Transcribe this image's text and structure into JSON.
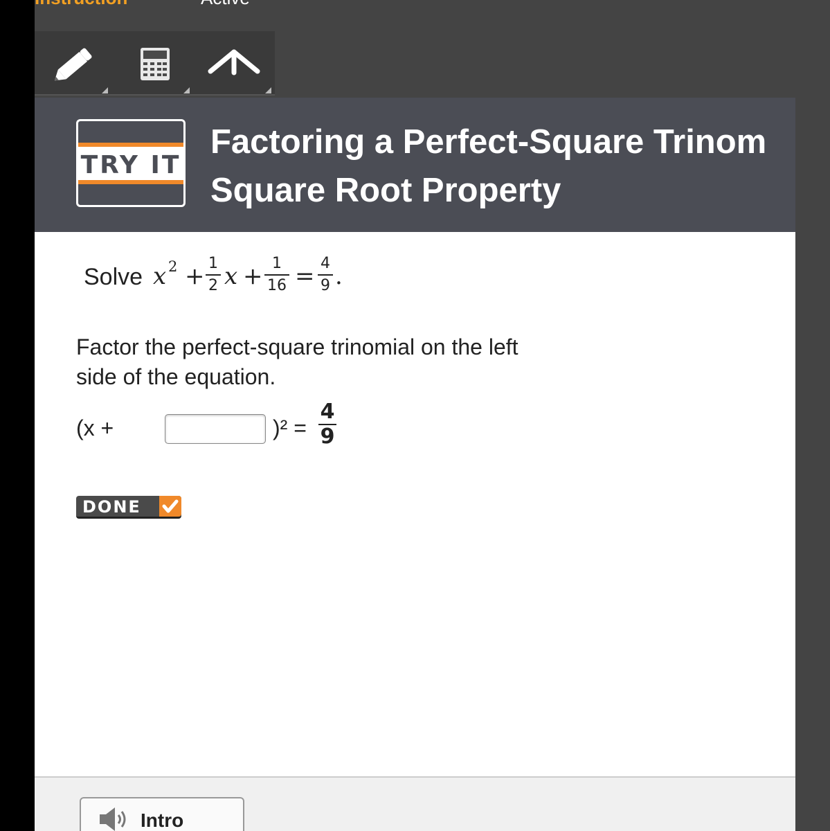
{
  "tabs": {
    "instruction": "Instruction",
    "active": "Active"
  },
  "toolbar": {
    "tools": [
      {
        "name": "pencil-icon"
      },
      {
        "name": "calculator-icon"
      },
      {
        "name": "up-arrow-icon"
      }
    ]
  },
  "header": {
    "badge": "TRY IT",
    "title_line1": "Factoring a Perfect-Square Trinom",
    "title_line2": "Square Root Property"
  },
  "problem": {
    "word": "Solve",
    "x": "x",
    "exp": "2",
    "plus": "+",
    "f1_num": "1",
    "f1_den": "2",
    "f2_num": "1",
    "f2_den": "16",
    "eq": "=",
    "f3_num": "4",
    "f3_den": "9",
    "period": "."
  },
  "instructions": {
    "line1": "Factor the perfect-square trinomial on the left",
    "line2": "side of the equation."
  },
  "equation": {
    "prefix": "(x +",
    "answer_value": "",
    "suffix": ")² =",
    "rhs_num": "4",
    "rhs_den": "9"
  },
  "done_button": {
    "label": "DONE"
  },
  "footer": {
    "intro_label": "Intro"
  },
  "colors": {
    "accent": "#f0892a",
    "header_bg": "#4b4d55",
    "tab_active_text": "#f2a023"
  }
}
